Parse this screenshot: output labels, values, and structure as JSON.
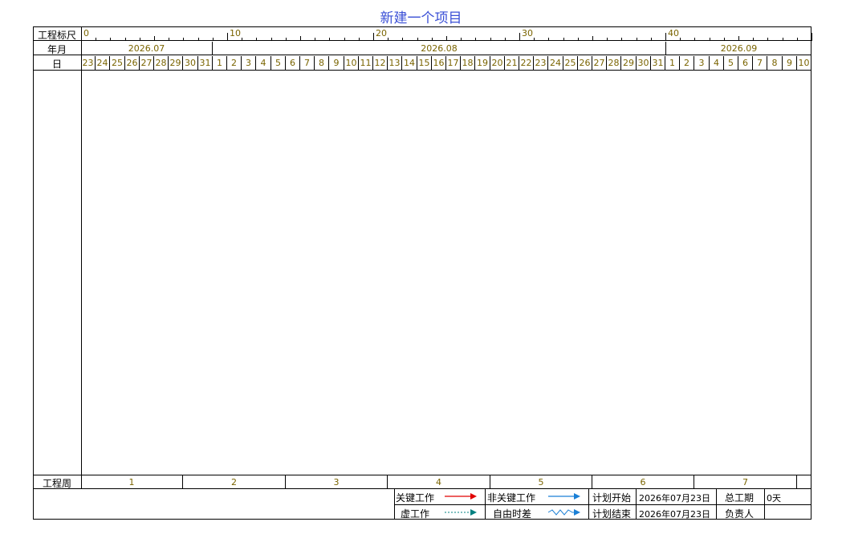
{
  "title": "新建一个项目",
  "row_labels": {
    "ruler": "工程标尺",
    "month": "年月",
    "day": "日",
    "week": "工程周"
  },
  "ruler_marks": [
    "0",
    "10",
    "20",
    "30",
    "40"
  ],
  "months": [
    "2026.07",
    "2026.08",
    "2026.09"
  ],
  "days": [
    "23",
    "24",
    "25",
    "26",
    "27",
    "28",
    "29",
    "30",
    "31",
    "1",
    "2",
    "3",
    "4",
    "5",
    "6",
    "7",
    "8",
    "9",
    "10",
    "11",
    "12",
    "13",
    "14",
    "15",
    "16",
    "17",
    "18",
    "19",
    "20",
    "21",
    "22",
    "23",
    "24",
    "25",
    "26",
    "27",
    "28",
    "29",
    "30",
    "31",
    "1",
    "2",
    "3",
    "4",
    "5",
    "6",
    "7",
    "8",
    "9",
    "10"
  ],
  "weeks": [
    "1",
    "2",
    "3",
    "4",
    "5",
    "6",
    "7"
  ],
  "legend": {
    "critical": "关键工作",
    "noncritical": "非关键工作",
    "dummy": "虚工作",
    "free_float": "自由时差",
    "plan_start_label": "计划开始",
    "plan_start_value": "2026年07月23日",
    "plan_end_label": "计划结束",
    "plan_end_value": "2026年07月23日",
    "total_duration_label": "总工期",
    "total_duration_value": "0天",
    "owner_label": "负责人",
    "owner_value": ""
  },
  "colors": {
    "critical": "#e00000",
    "noncritical": "#1a7fd6",
    "dummy": "#008080",
    "free_float": "#1a7fd6",
    "title": "#3a4fd6"
  }
}
